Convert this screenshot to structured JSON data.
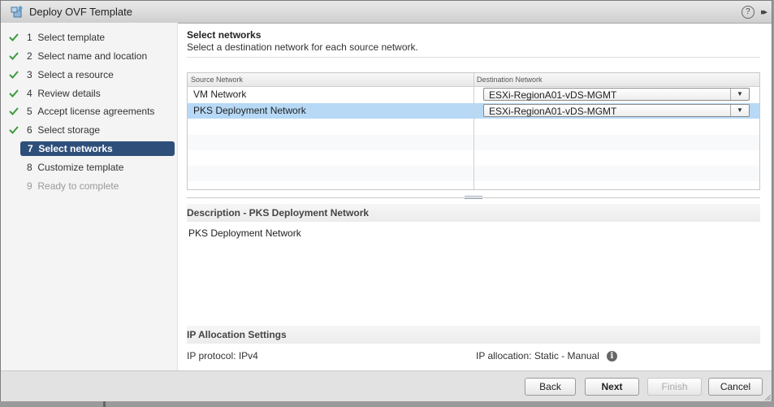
{
  "window": {
    "title": "Deploy OVF Template",
    "help": "?",
    "expand": "▸▸"
  },
  "steps": [
    {
      "num": "1",
      "label": "Select template",
      "state": "done"
    },
    {
      "num": "2",
      "label": "Select name and location",
      "state": "done"
    },
    {
      "num": "3",
      "label": "Select a resource",
      "state": "done"
    },
    {
      "num": "4",
      "label": "Review details",
      "state": "done"
    },
    {
      "num": "5",
      "label": "Accept license agreements",
      "state": "done"
    },
    {
      "num": "6",
      "label": "Select storage",
      "state": "done"
    },
    {
      "num": "7",
      "label": "Select networks",
      "state": "active"
    },
    {
      "num": "8",
      "label": "Customize template",
      "state": "pending"
    },
    {
      "num": "9",
      "label": "Ready to complete",
      "state": "disabled"
    }
  ],
  "main": {
    "title": "Select networks",
    "subtitle": "Select a destination network for each source network.",
    "grid": {
      "col_source": "Source Network",
      "col_destination": "Destination Network",
      "rows": [
        {
          "source": "VM Network",
          "destination": "ESXi-RegionA01-vDS-MGMT"
        },
        {
          "source": "PKS Deployment Network",
          "destination": "ESXi-RegionA01-vDS-MGMT"
        }
      ]
    },
    "description": {
      "heading": "Description - PKS Deployment Network",
      "text": "PKS Deployment Network"
    },
    "ip": {
      "heading": "IP Allocation Settings",
      "protocol_label": "IP protocol:",
      "protocol_value": "IPv4",
      "allocation_label": "IP allocation:",
      "allocation_value": "Static - Manual"
    }
  },
  "footer": {
    "back": "Back",
    "next": "Next",
    "finish": "Finish",
    "cancel": "Cancel"
  },
  "colors": {
    "accent": "#2e4f7a",
    "selected_row": "#b7d9f6",
    "check": "#3c9a3c"
  }
}
